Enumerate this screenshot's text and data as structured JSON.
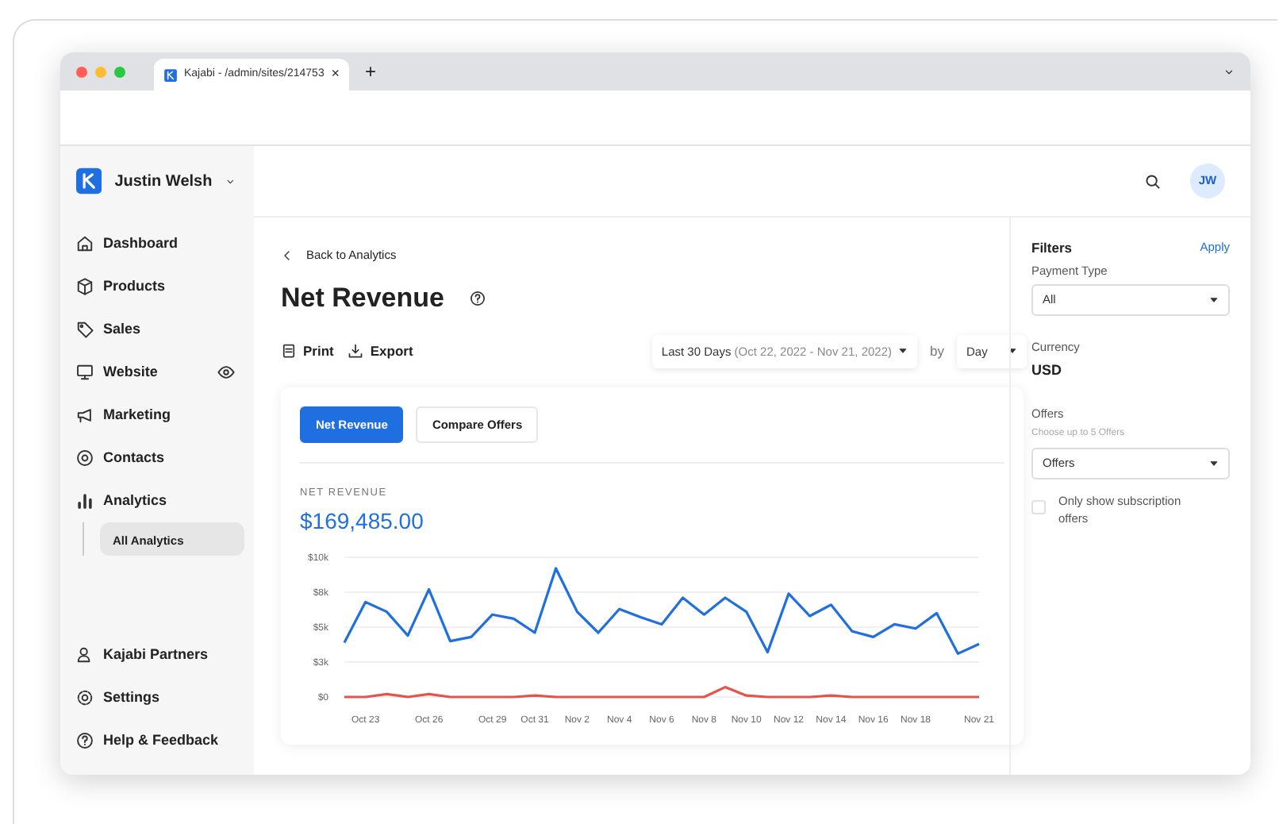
{
  "browser": {
    "tabs": [
      {
        "title": "Kajabi - /admin/sites/214753",
        "close": "×",
        "selected": true
      }
    ],
    "new_tab": "+"
  },
  "sidebar": {
    "account": {
      "name": "Justin Welsh"
    },
    "items": [
      {
        "label": "Dashboard",
        "selected": false
      },
      {
        "label": "Products",
        "selected": false
      },
      {
        "label": "Sales",
        "selected": false
      },
      {
        "label": "Website",
        "selected": false
      },
      {
        "label": "Marketing",
        "selected": false
      },
      {
        "label": "Contacts",
        "selected": false
      },
      {
        "label": "Analytics",
        "selected": false,
        "children": [
          {
            "label": "All Analytics",
            "selected": true
          }
        ]
      }
    ],
    "bottom_items": [
      {
        "label": "Kajabi Partners"
      },
      {
        "label": "Settings"
      },
      {
        "label": "Help & Feedback"
      }
    ]
  },
  "header": {
    "avatar": "JW"
  },
  "main": {
    "back_link": "Back to Analytics",
    "title": "Net Revenue",
    "actions": [
      "Print",
      "Export"
    ],
    "date_range": {
      "label": "Last 30 Days",
      "range": "(Oct 22, 2022 - Nov 21, 2022)"
    },
    "by": "by",
    "interval": "Day",
    "card": {
      "tabs": [
        {
          "label": "Net Revenue",
          "selected": true
        },
        {
          "label": "Compare Offers",
          "selected": false
        }
      ],
      "metric_label": "NET REVENUE",
      "metric_value": "$169,485.00",
      "chart_data": {
        "type": "line",
        "categories": [
          null,
          "Oct 23",
          null,
          null,
          "Oct 26",
          null,
          null,
          "Oct 29",
          null,
          "Oct 31",
          null,
          "Nov 2",
          null,
          "Nov 4",
          null,
          "Nov 6",
          null,
          "Nov 8",
          null,
          "Nov 10",
          null,
          "Nov 12",
          null,
          "Nov 14",
          null,
          "Nov 16",
          null,
          "Nov 18",
          null,
          null,
          "Nov 21"
        ],
        "grid": true,
        "series": [
          {
            "color": "#1f6fe0",
            "values": [
              3900,
              6800,
              6100,
              4400,
              7700,
              4000,
              4300,
              5900,
              5600,
              4600,
              9200,
              6100,
              4600,
              6300,
              5700,
              5200,
              7100,
              5900,
              7100,
              6100,
              3200,
              7400,
              5800,
              6600,
              4700,
              4300,
              5200,
              4900,
              6000,
              3100,
              3800
            ]
          },
          {
            "color": "#e5544b",
            "values": [
              0,
              0,
              200,
              0,
              200,
              0,
              0,
              0,
              0,
              100,
              0,
              0,
              0,
              0,
              0,
              0,
              0,
              0,
              700,
              100,
              0,
              0,
              0,
              100,
              0,
              0,
              0,
              0,
              0,
              0,
              0
            ]
          }
        ],
        "ylim": [
          0,
          10000
        ],
        "yticks": [
          {
            "value": 0,
            "label": "$0"
          },
          {
            "value": 2500,
            "label": "$3k"
          },
          {
            "value": 5000,
            "label": "$5k"
          },
          {
            "value": 7500,
            "label": "$8k"
          },
          {
            "value": 10000,
            "label": "$10k"
          }
        ]
      }
    }
  },
  "filters": {
    "title": "Filters",
    "apply": "Apply",
    "payment_type": {
      "label": "Payment Type",
      "value": "All"
    },
    "currency": {
      "label": "Currency",
      "value": "USD"
    },
    "offers": {
      "label": "Offers",
      "hint": "Choose up to 5 Offers",
      "value": "Offers"
    },
    "subscription_only": {
      "label": "Only show subscription offers",
      "checked": false
    }
  }
}
